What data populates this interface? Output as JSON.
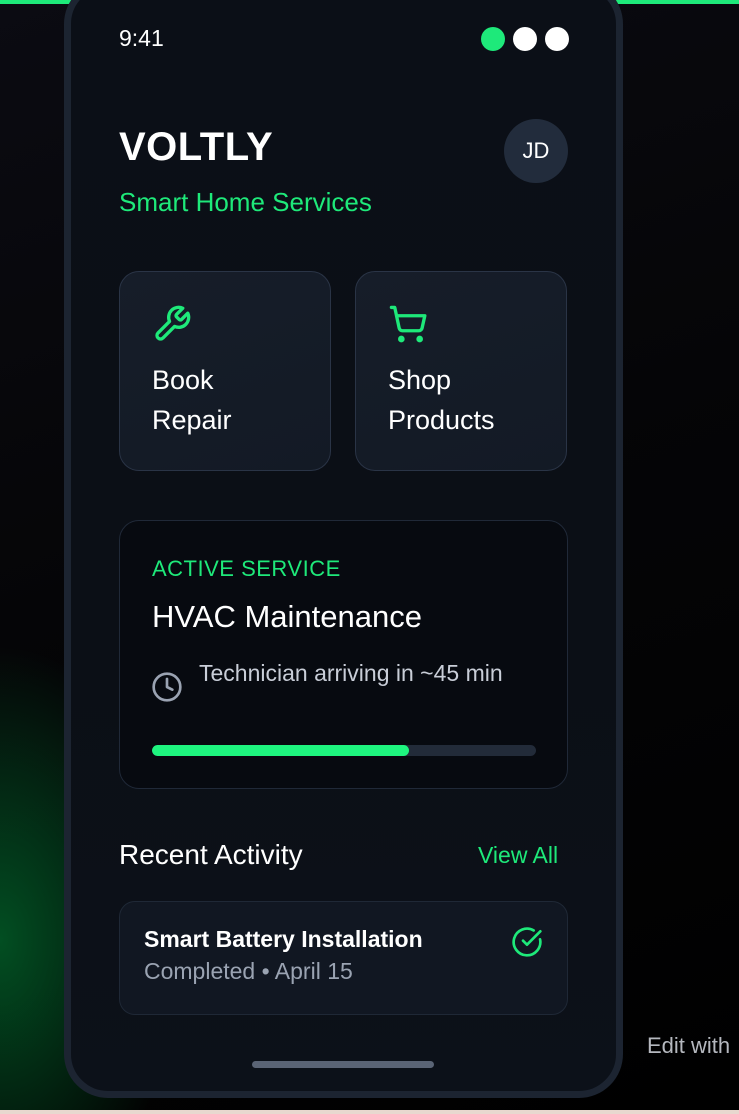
{
  "status_bar": {
    "time": "9:41",
    "dot_colors": [
      "#1ee97a",
      "#ffffff",
      "#ffffff"
    ]
  },
  "header": {
    "title": "VOLTLY",
    "subtitle": "Smart Home Services",
    "avatar_initials": "JD"
  },
  "quick_actions": [
    {
      "label_line1": "Book",
      "label_line2": "Repair",
      "icon": "wrench-icon"
    },
    {
      "label_line1": "Shop",
      "label_line2": "Products",
      "icon": "cart-icon"
    }
  ],
  "active_service": {
    "eyebrow": "ACTIVE SERVICE",
    "title": "HVAC Maintenance",
    "eta": "Technician arriving in ~45 min",
    "progress_fraction": 0.67,
    "icon": "clock-icon"
  },
  "recent_activity": {
    "title": "Recent Activity",
    "view_all_label": "View All",
    "items": [
      {
        "title": "Smart Battery Installation",
        "meta": "Completed • April 15",
        "icon": "check-circle-icon"
      }
    ]
  },
  "overlay": {
    "edit_label": "Edit with"
  },
  "colors": {
    "accent": "#1ee97a",
    "progress": "#1ef57f",
    "card_background": "#131a25",
    "screen_background": "#0b0f17"
  }
}
